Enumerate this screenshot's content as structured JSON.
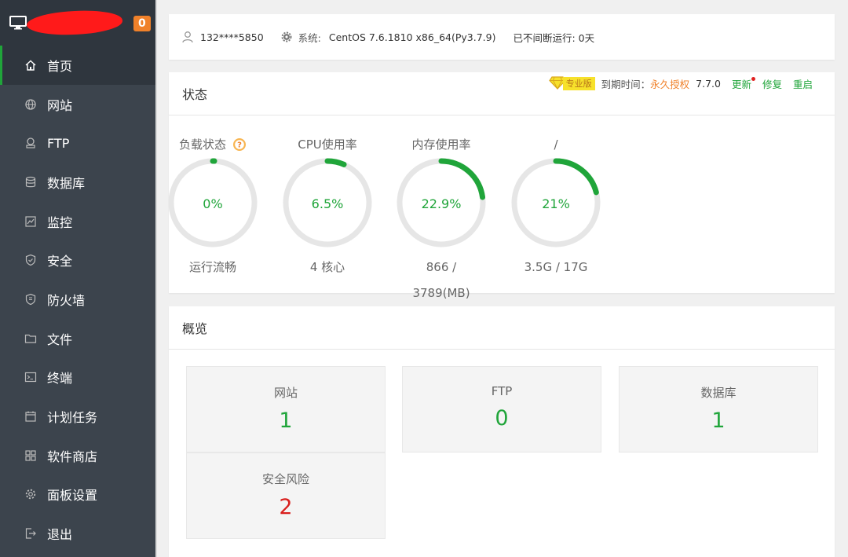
{
  "sidebar": {
    "badge": "0",
    "items": [
      {
        "label": "首页",
        "icon": "home-icon",
        "active": true
      },
      {
        "label": "网站",
        "icon": "globe-icon"
      },
      {
        "label": "FTP",
        "icon": "ftp-icon"
      },
      {
        "label": "数据库",
        "icon": "database-icon"
      },
      {
        "label": "监控",
        "icon": "monitor-chart-icon"
      },
      {
        "label": "安全",
        "icon": "shield-icon"
      },
      {
        "label": "防火墙",
        "icon": "firewall-icon"
      },
      {
        "label": "文件",
        "icon": "folder-icon"
      },
      {
        "label": "终端",
        "icon": "terminal-icon"
      },
      {
        "label": "计划任务",
        "icon": "calendar-icon"
      },
      {
        "label": "软件商店",
        "icon": "apps-grid-icon"
      },
      {
        "label": "面板设置",
        "icon": "gear-icon"
      },
      {
        "label": "退出",
        "icon": "logout-icon"
      }
    ]
  },
  "topbar": {
    "user": "132****5850",
    "system_label": "系统:",
    "system_value": "CentOS 7.6.1810 x86_64(Py3.7.9)",
    "uptime": "已不间断运行: 0天"
  },
  "status": {
    "title": "状态",
    "pro_label": "专业版",
    "expire_label": "到期时间：",
    "expire_value": "永久授权",
    "version": "7.7.0",
    "update": "更新",
    "repair": "修复",
    "restart": "重启",
    "gauges": [
      {
        "title": "负载状态",
        "value": "0%",
        "percent": 0,
        "foot": "运行流畅",
        "help": true
      },
      {
        "title": "CPU使用率",
        "value": "6.5%",
        "percent": 6.5,
        "foot": "4 核心"
      },
      {
        "title": "内存使用率",
        "value": "22.9%",
        "percent": 22.9,
        "foot": "866 / 3789(MB)"
      },
      {
        "title": "/",
        "value": "21%",
        "percent": 21,
        "foot": "3.5G / 17G"
      }
    ]
  },
  "overview": {
    "title": "概览",
    "cards": [
      {
        "label": "网站",
        "value": "1",
        "danger": false
      },
      {
        "label": "FTP",
        "value": "0",
        "danger": false
      },
      {
        "label": "数据库",
        "value": "1",
        "danger": false
      },
      {
        "label": "安全风险",
        "value": "2",
        "danger": true
      }
    ]
  },
  "colors": {
    "accent": "#20a53a",
    "sidebar_bg": "#3c444d",
    "warning": "#f0812a",
    "danger": "#d9201e"
  }
}
